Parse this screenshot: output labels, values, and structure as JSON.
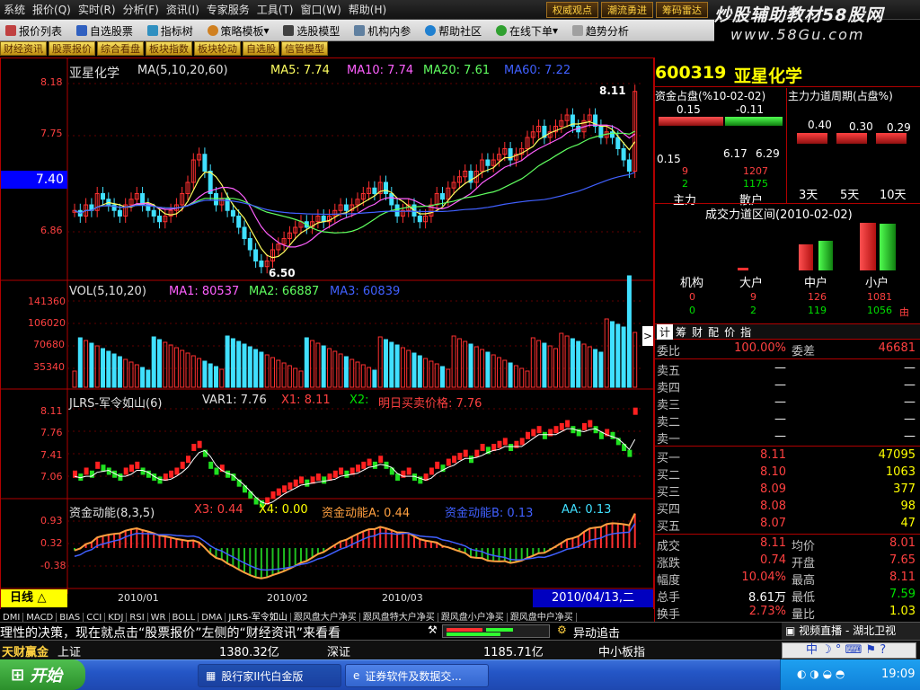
{
  "menu": [
    "系统",
    "报价",
    "实时",
    "分析",
    "资讯",
    "专家服务",
    "工具",
    "窗口",
    "帮助"
  ],
  "menu_keys": [
    "",
    "(Q)",
    "(R)",
    "(F)",
    "(I)",
    "",
    "(T)",
    "(W)",
    "(H)"
  ],
  "top_buttons": [
    "权威观点",
    "潮流勇进",
    "筹码雷达"
  ],
  "brand": {
    "line1": "炒股辅助教材58股网",
    "line2": "www.58Gu.com"
  },
  "toolbar": [
    "报价列表",
    "自选股票",
    "指标树",
    "策略模板",
    "选股模型",
    "机构内参",
    "帮助社区",
    "在线下单",
    "趋势分析"
  ],
  "tabs2": [
    "财经资讯",
    "股票报价",
    "综合看盘",
    "板块指数",
    "板块轮动",
    "自选股",
    "信管模型"
  ],
  "price_panel": {
    "name": "亚星化学",
    "ma_label": "MA(5,10,20,60)",
    "ma5": "MA5: 7.74",
    "ma10": "MA10: 7.74",
    "ma20": "MA20: 7.61",
    "ma60": "MA60: 7.22",
    "yticks": [
      "8.18",
      "7.75",
      "6.86"
    ],
    "current": "7.40",
    "high_mark": "8.11",
    "low_mark": "6.50"
  },
  "vol_panel": {
    "label": "VOL(5,10,20)",
    "ma1": "MA1: 80537",
    "ma2": "MA2: 66887",
    "ma3": "MA3: 60839",
    "yticks": [
      "141360",
      "106020",
      "70680",
      "35340"
    ]
  },
  "jlrs_panel": {
    "label": "JLRS-军令如山(6)",
    "var1": "VAR1: 7.76",
    "x1": "X1: 8.11",
    "x2": "X2:",
    "x2b": "明日买卖价格: 7.76",
    "yticks": [
      "8.11",
      "7.76",
      "7.41",
      "7.06"
    ]
  },
  "zj_panel": {
    "label": "资金动能(8,3,5)",
    "x3": "X3: 0.44",
    "x4": "X4: 0.00",
    "a": "资金动能A: 0.44",
    "b": "资金动能B: 0.13",
    "aa": "AA: 0.13",
    "yticks": [
      "0.93",
      "0.32",
      "-0.38"
    ]
  },
  "period": "日线",
  "dates": [
    "2010/01",
    "2010/02",
    "2010/03"
  ],
  "date_current": "2010/04/13,二",
  "indicator_tabs": [
    "DMI",
    "MACD",
    "BIAS",
    "CCI",
    "KDJ",
    "RSI",
    "WR",
    "BOLL",
    "DMA",
    "JLRS-军令如山",
    "跟风盘大户净买",
    "跟风盘特大户净买",
    "跟风盘小户净买",
    "跟风盘中户净买"
  ],
  "stock": {
    "code": "600319",
    "name": "亚星化学"
  },
  "fund": {
    "title": "资金占盘(%10-02-02)",
    "title2": "主力力道周期(占盘%)",
    "v1": "0.15",
    "v2": "-0.11",
    "v3": "0.15",
    "v4": "6.17",
    "v5": "6.29",
    "v6": "9",
    "v7": "1207",
    "v8": "2",
    "v9": "1175",
    "lab1": "主力",
    "lab2": "散户",
    "p1": "0.40",
    "p2": "0.30",
    "p3": "0.29",
    "d1": "3天",
    "d2": "5天",
    "d3": "10天"
  },
  "range": {
    "title": "成交力道区间(2010-02-02)",
    "cats": [
      "机构",
      "大户",
      "中户",
      "小户"
    ],
    "row1": [
      "0",
      "9",
      "126",
      "1081"
    ],
    "row2": [
      "0",
      "2",
      "119",
      "1056"
    ],
    "flag": "由"
  },
  "quote_tabs": [
    "计",
    "筹",
    "财",
    "配",
    "价",
    "指"
  ],
  "quote": {
    "weibi": "委比",
    "weibi_v": "100.00%",
    "weicha": "委差",
    "weicha_v": "46681",
    "asks": [
      {
        "l": "卖五",
        "p": "—",
        "v": "—"
      },
      {
        "l": "卖四",
        "p": "—",
        "v": "—"
      },
      {
        "l": "卖三",
        "p": "—",
        "v": "—"
      },
      {
        "l": "卖二",
        "p": "—",
        "v": "—"
      },
      {
        "l": "卖一",
        "p": "—",
        "v": "—"
      }
    ],
    "bids": [
      {
        "l": "买一",
        "p": "8.11",
        "v": "47095"
      },
      {
        "l": "买二",
        "p": "8.10",
        "v": "1063"
      },
      {
        "l": "买三",
        "p": "8.09",
        "v": "377"
      },
      {
        "l": "买四",
        "p": "8.08",
        "v": "98"
      },
      {
        "l": "买五",
        "p": "8.07",
        "v": "47"
      }
    ],
    "stats": [
      {
        "a": "成交",
        "b": "8.11",
        "c": "均价",
        "d": "8.01"
      },
      {
        "a": "涨跌",
        "b": "0.74",
        "c": "开盘",
        "d": "7.65"
      },
      {
        "a": "幅度",
        "b": "10.04%",
        "c": "最高",
        "d": "8.11"
      },
      {
        "a": "总手",
        "b": "8.61万",
        "c": "最低",
        "d": "7.59"
      },
      {
        "a": "换手",
        "b": "2.73%",
        "c": "量比",
        "d": "1.03"
      }
    ]
  },
  "ticker": "理性的决策，现在就点击“股票报价”左侧的“财经资讯”来看看",
  "ticker_right": "异动追击",
  "video": "视频直播 - 湖北卫视",
  "indexbar": {
    "brand": "天财赢金",
    "sh": "上证",
    "sh_v": "1380.32亿",
    "sz": "深证",
    "sz_v": "1185.71亿",
    "mid": "中小板指"
  },
  "taskbar": {
    "start": "开始",
    "t1": "股行家II代白金版",
    "t2": "证券软件及数据交...",
    "time": "19:09",
    "ime": "中"
  }
}
